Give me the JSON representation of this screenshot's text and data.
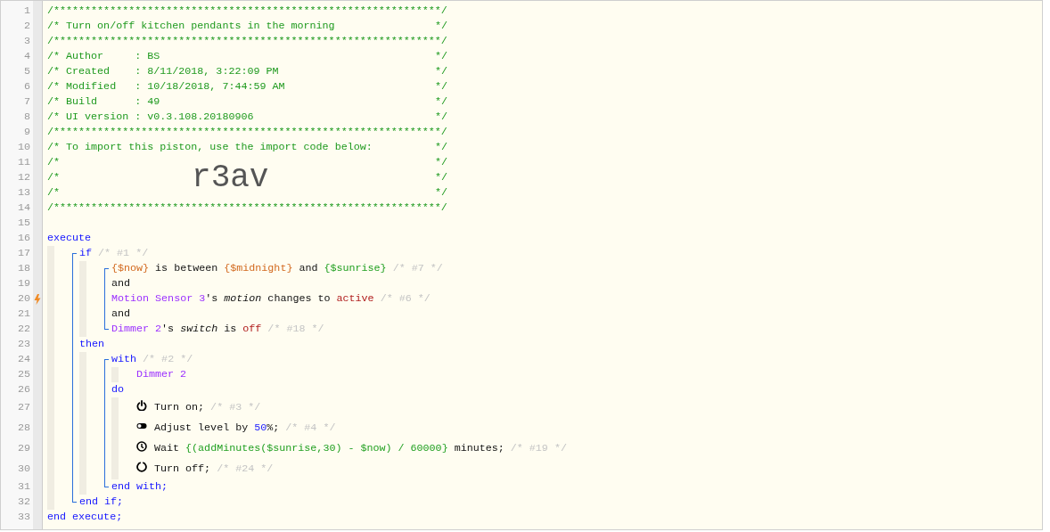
{
  "code": [
    {
      "kind": "line",
      "number": "1",
      "tokens": [
        {
          "kind": "comment",
          "text": "/**************************************************************/"
        }
      ]
    },
    {
      "kind": "line",
      "number": "2",
      "tokens": [
        {
          "kind": "comment",
          "text": "/* Turn on/off kitchen pendants in the morning"
        },
        {
          "kind": "comment_end",
          "text": "*/"
        }
      ]
    },
    {
      "kind": "line",
      "number": "3",
      "tokens": [
        {
          "kind": "comment",
          "text": "/**************************************************************/"
        }
      ]
    },
    {
      "kind": "line",
      "number": "4",
      "tokens": [
        {
          "kind": "comment",
          "text": "/* Author     : BS"
        },
        {
          "kind": "comment_end",
          "text": "*/"
        }
      ]
    },
    {
      "kind": "line",
      "number": "5",
      "tokens": [
        {
          "kind": "comment",
          "text": "/* Created    : 8/11/2018, 3:22:09 PM"
        },
        {
          "kind": "comment_end",
          "text": "*/"
        }
      ]
    },
    {
      "kind": "line",
      "number": "6",
      "tokens": [
        {
          "kind": "comment",
          "text": "/* Modified   : 10/18/2018, 7:44:59 AM"
        },
        {
          "kind": "comment_end",
          "text": "*/"
        }
      ]
    },
    {
      "kind": "line",
      "number": "7",
      "tokens": [
        {
          "kind": "comment",
          "text": "/* Build      : 49"
        },
        {
          "kind": "comment_end",
          "text": "*/"
        }
      ]
    },
    {
      "kind": "line",
      "number": "8",
      "tokens": [
        {
          "kind": "comment",
          "text": "/* UI version : v0.3.108.20180906"
        },
        {
          "kind": "comment_end",
          "text": "*/"
        }
      ]
    },
    {
      "kind": "line",
      "number": "9",
      "tokens": [
        {
          "kind": "comment",
          "text": "/**************************************************************/"
        }
      ]
    },
    {
      "kind": "line",
      "number": "10",
      "tokens": [
        {
          "kind": "comment",
          "text": "/* To import this piston, use the import code below:"
        },
        {
          "kind": "comment_end",
          "text": "*/"
        }
      ]
    },
    {
      "kind": "line",
      "number": "11",
      "tokens": [
        {
          "kind": "comment",
          "text": "/*"
        },
        {
          "kind": "comment_end",
          "text": "*/"
        }
      ]
    },
    {
      "kind": "line",
      "number": "12",
      "tokens": [
        {
          "kind": "comment",
          "text": "/*"
        },
        {
          "kind": "code",
          "text": "r3av"
        },
        {
          "kind": "comment_end",
          "text": "*/"
        }
      ]
    },
    {
      "kind": "line",
      "number": "13",
      "tokens": [
        {
          "kind": "comment",
          "text": "/*"
        },
        {
          "kind": "comment_end",
          "text": "*/"
        }
      ]
    },
    {
      "kind": "line",
      "number": "14",
      "tokens": [
        {
          "kind": "comment",
          "text": "/**************************************************************/"
        }
      ]
    },
    {
      "kind": "line",
      "number": "15"
    },
    {
      "kind": "line",
      "number": "16",
      "tokens": [
        {
          "kind": "keyword",
          "text": "execute"
        }
      ]
    },
    {
      "kind": "indent",
      "children": [
        {
          "kind": "bracket",
          "children": [
            {
              "kind": "line",
              "number": "17",
              "tokens": [
                {
                  "kind": "keyword",
                  "text": "if"
                },
                {
                  "kind": "note",
                  "text": " /* #1 */"
                }
              ]
            },
            {
              "kind": "indent",
              "children": [
                {
                  "kind": "bracket",
                  "children": [
                    {
                      "kind": "line",
                      "number": "18",
                      "tokens": [
                        {
                          "kind": "variable",
                          "text": "{$now}"
                        },
                        {
                          "kind": "plain",
                          "text": " is between "
                        },
                        {
                          "kind": "variable",
                          "text": "{$midnight}"
                        },
                        {
                          "kind": "plain",
                          "text": " and "
                        },
                        {
                          "kind": "expression",
                          "text": "{$sunrise}"
                        },
                        {
                          "kind": "note",
                          "text": " /* #7 */"
                        }
                      ]
                    },
                    {
                      "kind": "line",
                      "number": "19",
                      "tokens": [
                        {
                          "kind": "plain",
                          "text": "and"
                        }
                      ]
                    },
                    {
                      "kind": "line",
                      "number": "20",
                      "trigger": true,
                      "tokens": [
                        {
                          "kind": "device",
                          "text": "Motion Sensor 3"
                        },
                        {
                          "kind": "plain",
                          "text": "'s "
                        },
                        {
                          "kind": "attribute",
                          "text": "motion"
                        },
                        {
                          "kind": "plain",
                          "text": " changes to "
                        },
                        {
                          "kind": "value",
                          "text": "active"
                        },
                        {
                          "kind": "note",
                          "text": " /* #6 */"
                        }
                      ]
                    },
                    {
                      "kind": "line",
                      "number": "21",
                      "tokens": [
                        {
                          "kind": "plain",
                          "text": "and"
                        }
                      ]
                    },
                    {
                      "kind": "line",
                      "number": "22",
                      "tokens": [
                        {
                          "kind": "device",
                          "text": "Dimmer 2"
                        },
                        {
                          "kind": "plain",
                          "text": "'s "
                        },
                        {
                          "kind": "attribute",
                          "text": "switch"
                        },
                        {
                          "kind": "plain",
                          "text": " is "
                        },
                        {
                          "kind": "value",
                          "text": "off"
                        },
                        {
                          "kind": "note",
                          "text": " /* #18 */"
                        }
                      ]
                    }
                  ]
                }
              ]
            },
            {
              "kind": "line",
              "number": "23",
              "tokens": [
                {
                  "kind": "keyword",
                  "text": "then"
                }
              ]
            },
            {
              "kind": "indent",
              "children": [
                {
                  "kind": "bracket",
                  "children": [
                    {
                      "kind": "line",
                      "number": "24",
                      "tokens": [
                        {
                          "kind": "keyword",
                          "text": "with"
                        },
                        {
                          "kind": "note",
                          "text": " /* #2 */"
                        }
                      ]
                    },
                    {
                      "kind": "indent",
                      "children": [
                        {
                          "kind": "line",
                          "number": "25",
                          "tokens": [
                            {
                              "kind": "device",
                              "text": "Dimmer 2"
                            }
                          ]
                        }
                      ]
                    },
                    {
                      "kind": "line",
                      "number": "26",
                      "tokens": [
                        {
                          "kind": "keyword",
                          "text": "do"
                        }
                      ]
                    },
                    {
                      "kind": "indent",
                      "children": [
                        {
                          "kind": "on",
                          "number": "27",
                          "tokens": [
                            {
                              "kind": "plain",
                              "text": "Turn on;"
                            },
                            {
                              "kind": "note",
                              "text": " /* #3 */"
                            }
                          ]
                        },
                        {
                          "kind": "level",
                          "number": "28",
                          "tokens": [
                            {
                              "kind": "plain",
                              "text": "Adjust level by "
                            },
                            {
                              "kind": "number",
                              "text": "50"
                            },
                            {
                              "kind": "plain",
                              "text": "%;"
                            },
                            {
                              "kind": "note",
                              "text": " /* #4 */"
                            }
                          ]
                        },
                        {
                          "kind": "wait",
                          "number": "29",
                          "tokens": [
                            {
                              "kind": "plain",
                              "text": "Wait "
                            },
                            {
                              "kind": "expression",
                              "text": "{(addMinutes($sunrise,30) - $now) / 60000}"
                            },
                            {
                              "kind": "plain",
                              "text": " minutes;"
                            },
                            {
                              "kind": "note",
                              "text": " /* #19 */"
                            }
                          ]
                        },
                        {
                          "kind": "off",
                          "number": "30",
                          "tokens": [
                            {
                              "kind": "plain",
                              "text": "Turn off;"
                            },
                            {
                              "kind": "note",
                              "text": " /* #24 */"
                            }
                          ]
                        }
                      ]
                    },
                    {
                      "kind": "line",
                      "number": "31",
                      "tokens": [
                        {
                          "kind": "keyword",
                          "text": "end with;"
                        }
                      ]
                    }
                  ]
                }
              ]
            },
            {
              "kind": "line",
              "number": "32",
              "tokens": [
                {
                  "kind": "keyword",
                  "text": "end if;"
                }
              ]
            }
          ]
        }
      ]
    },
    {
      "kind": "line",
      "number": "33",
      "tokens": [
        {
          "kind": "keyword",
          "text": "end execute;"
        }
      ]
    }
  ]
}
